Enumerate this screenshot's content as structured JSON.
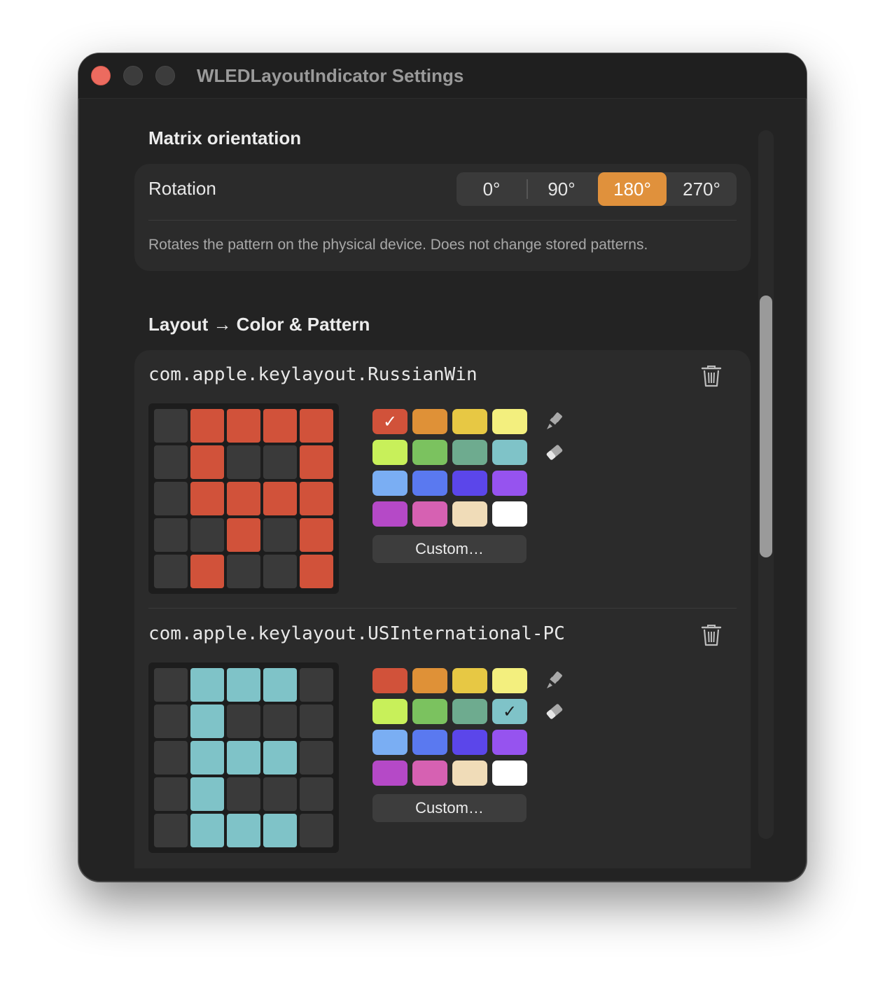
{
  "window": {
    "title": "WLEDLayoutIndicator Settings"
  },
  "orientation": {
    "section_title": "Matrix orientation",
    "row_label": "Rotation",
    "options": [
      "0°",
      "90°",
      "180°",
      "270°"
    ],
    "selected": "180°",
    "description": "Rotates the pattern on the physical device. Does not change stored patterns."
  },
  "layouts": {
    "section_title": "Layout → Color & Pattern",
    "palette": [
      "#d1523a",
      "#df9137",
      "#e7c844",
      "#f3ef7e",
      "#c8f05a",
      "#7bc25f",
      "#6eab8f",
      "#7fc3c8",
      "#7aaef3",
      "#5a79f0",
      "#5b46ea",
      "#9653ef",
      "#b549c7",
      "#d661b2",
      "#f0dcb8",
      "#ffffff"
    ],
    "custom_label": "Custom…",
    "items": [
      {
        "name": "com.apple.keylayout.RussianWin",
        "color": "#d1523a",
        "selected_swatch": 0,
        "check_color": "#ffffff",
        "pattern": [
          [
            0,
            1,
            1,
            1,
            1
          ],
          [
            0,
            1,
            0,
            0,
            1
          ],
          [
            0,
            1,
            1,
            1,
            1
          ],
          [
            0,
            0,
            1,
            0,
            1
          ],
          [
            0,
            1,
            0,
            0,
            1
          ]
        ]
      },
      {
        "name": "com.apple.keylayout.USInternational-PC",
        "color": "#7fc3c8",
        "selected_swatch": 7,
        "check_color": "#1d1d1d",
        "pattern": [
          [
            0,
            1,
            1,
            1,
            0
          ],
          [
            0,
            1,
            0,
            0,
            0
          ],
          [
            0,
            1,
            1,
            1,
            0
          ],
          [
            0,
            1,
            0,
            0,
            0
          ],
          [
            0,
            1,
            1,
            1,
            0
          ]
        ]
      }
    ]
  },
  "colors": {
    "accent": "#e0913c",
    "background": "#232323",
    "card": "#2b2b2b"
  }
}
